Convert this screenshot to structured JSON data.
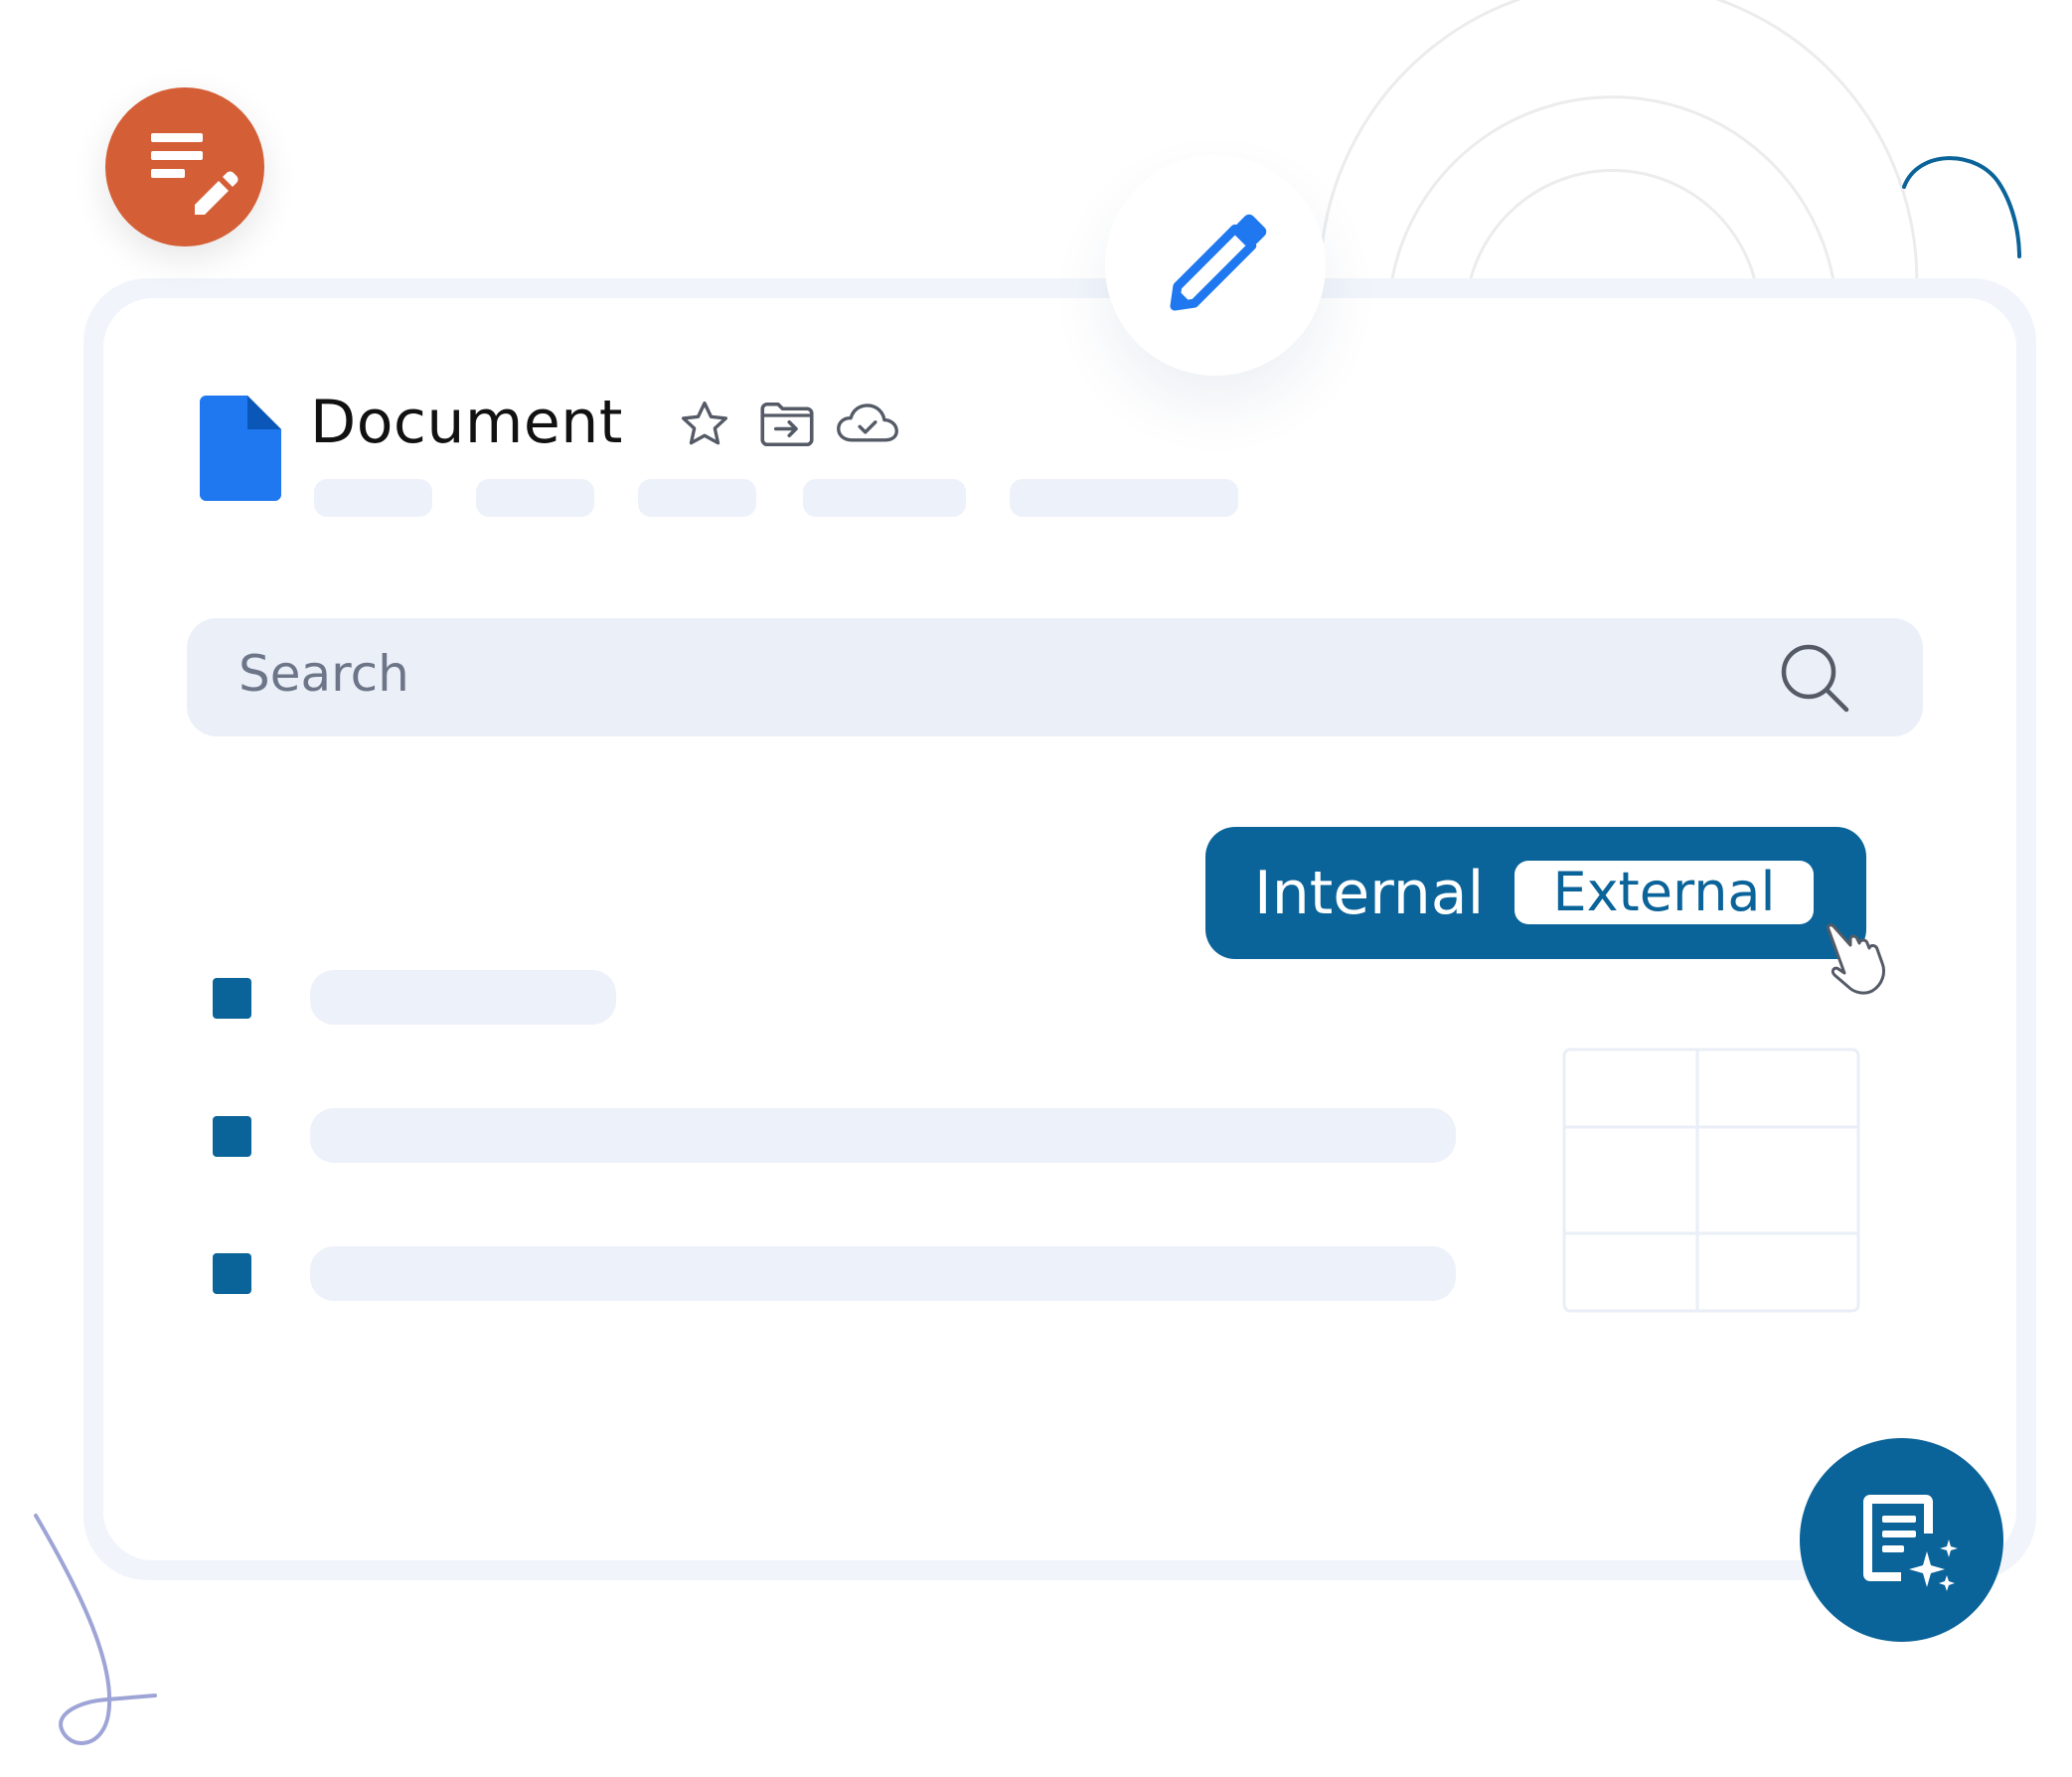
{
  "colors": {
    "accent": "#0a6399",
    "orange": "#d45e36",
    "doc_blue": "#1f78f0",
    "placeholder": "#edf1f9"
  },
  "header": {
    "title": "Document",
    "icons": [
      "document-icon",
      "star-icon",
      "move-to-folder-icon",
      "cloud-saved-icon"
    ]
  },
  "search": {
    "placeholder": "Search",
    "icon": "search-icon"
  },
  "toggle": {
    "options": [
      "Internal",
      "External"
    ],
    "selected": "External"
  },
  "floating": {
    "top_left": "edit-notes-icon",
    "top_center": "pencil-icon",
    "bottom_right": "ai-document-icon"
  },
  "list": {
    "item_count": 3
  },
  "table": {
    "rows": 3,
    "columns": 2
  }
}
